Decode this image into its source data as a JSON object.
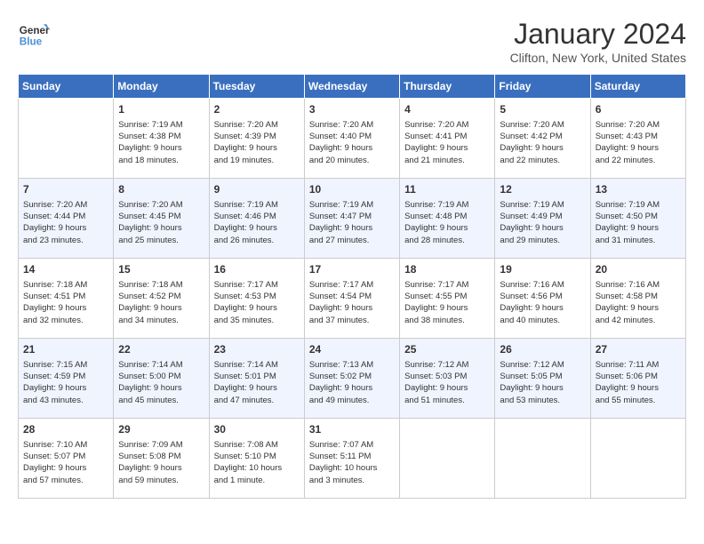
{
  "logo": {
    "text_general": "General",
    "text_blue": "Blue"
  },
  "header": {
    "month": "January 2024",
    "location": "Clifton, New York, United States"
  },
  "days_of_week": [
    "Sunday",
    "Monday",
    "Tuesday",
    "Wednesday",
    "Thursday",
    "Friday",
    "Saturday"
  ],
  "weeks": [
    [
      {
        "day": "",
        "info": ""
      },
      {
        "day": "1",
        "info": "Sunrise: 7:19 AM\nSunset: 4:38 PM\nDaylight: 9 hours\nand 18 minutes."
      },
      {
        "day": "2",
        "info": "Sunrise: 7:20 AM\nSunset: 4:39 PM\nDaylight: 9 hours\nand 19 minutes."
      },
      {
        "day": "3",
        "info": "Sunrise: 7:20 AM\nSunset: 4:40 PM\nDaylight: 9 hours\nand 20 minutes."
      },
      {
        "day": "4",
        "info": "Sunrise: 7:20 AM\nSunset: 4:41 PM\nDaylight: 9 hours\nand 21 minutes."
      },
      {
        "day": "5",
        "info": "Sunrise: 7:20 AM\nSunset: 4:42 PM\nDaylight: 9 hours\nand 22 minutes."
      },
      {
        "day": "6",
        "info": "Sunrise: 7:20 AM\nSunset: 4:43 PM\nDaylight: 9 hours\nand 22 minutes."
      }
    ],
    [
      {
        "day": "7",
        "info": "Sunrise: 7:20 AM\nSunset: 4:44 PM\nDaylight: 9 hours\nand 23 minutes."
      },
      {
        "day": "8",
        "info": "Sunrise: 7:20 AM\nSunset: 4:45 PM\nDaylight: 9 hours\nand 25 minutes."
      },
      {
        "day": "9",
        "info": "Sunrise: 7:19 AM\nSunset: 4:46 PM\nDaylight: 9 hours\nand 26 minutes."
      },
      {
        "day": "10",
        "info": "Sunrise: 7:19 AM\nSunset: 4:47 PM\nDaylight: 9 hours\nand 27 minutes."
      },
      {
        "day": "11",
        "info": "Sunrise: 7:19 AM\nSunset: 4:48 PM\nDaylight: 9 hours\nand 28 minutes."
      },
      {
        "day": "12",
        "info": "Sunrise: 7:19 AM\nSunset: 4:49 PM\nDaylight: 9 hours\nand 29 minutes."
      },
      {
        "day": "13",
        "info": "Sunrise: 7:19 AM\nSunset: 4:50 PM\nDaylight: 9 hours\nand 31 minutes."
      }
    ],
    [
      {
        "day": "14",
        "info": "Sunrise: 7:18 AM\nSunset: 4:51 PM\nDaylight: 9 hours\nand 32 minutes."
      },
      {
        "day": "15",
        "info": "Sunrise: 7:18 AM\nSunset: 4:52 PM\nDaylight: 9 hours\nand 34 minutes."
      },
      {
        "day": "16",
        "info": "Sunrise: 7:17 AM\nSunset: 4:53 PM\nDaylight: 9 hours\nand 35 minutes."
      },
      {
        "day": "17",
        "info": "Sunrise: 7:17 AM\nSunset: 4:54 PM\nDaylight: 9 hours\nand 37 minutes."
      },
      {
        "day": "18",
        "info": "Sunrise: 7:17 AM\nSunset: 4:55 PM\nDaylight: 9 hours\nand 38 minutes."
      },
      {
        "day": "19",
        "info": "Sunrise: 7:16 AM\nSunset: 4:56 PM\nDaylight: 9 hours\nand 40 minutes."
      },
      {
        "day": "20",
        "info": "Sunrise: 7:16 AM\nSunset: 4:58 PM\nDaylight: 9 hours\nand 42 minutes."
      }
    ],
    [
      {
        "day": "21",
        "info": "Sunrise: 7:15 AM\nSunset: 4:59 PM\nDaylight: 9 hours\nand 43 minutes."
      },
      {
        "day": "22",
        "info": "Sunrise: 7:14 AM\nSunset: 5:00 PM\nDaylight: 9 hours\nand 45 minutes."
      },
      {
        "day": "23",
        "info": "Sunrise: 7:14 AM\nSunset: 5:01 PM\nDaylight: 9 hours\nand 47 minutes."
      },
      {
        "day": "24",
        "info": "Sunrise: 7:13 AM\nSunset: 5:02 PM\nDaylight: 9 hours\nand 49 minutes."
      },
      {
        "day": "25",
        "info": "Sunrise: 7:12 AM\nSunset: 5:03 PM\nDaylight: 9 hours\nand 51 minutes."
      },
      {
        "day": "26",
        "info": "Sunrise: 7:12 AM\nSunset: 5:05 PM\nDaylight: 9 hours\nand 53 minutes."
      },
      {
        "day": "27",
        "info": "Sunrise: 7:11 AM\nSunset: 5:06 PM\nDaylight: 9 hours\nand 55 minutes."
      }
    ],
    [
      {
        "day": "28",
        "info": "Sunrise: 7:10 AM\nSunset: 5:07 PM\nDaylight: 9 hours\nand 57 minutes."
      },
      {
        "day": "29",
        "info": "Sunrise: 7:09 AM\nSunset: 5:08 PM\nDaylight: 9 hours\nand 59 minutes."
      },
      {
        "day": "30",
        "info": "Sunrise: 7:08 AM\nSunset: 5:10 PM\nDaylight: 10 hours\nand 1 minute."
      },
      {
        "day": "31",
        "info": "Sunrise: 7:07 AM\nSunset: 5:11 PM\nDaylight: 10 hours\nand 3 minutes."
      },
      {
        "day": "",
        "info": ""
      },
      {
        "day": "",
        "info": ""
      },
      {
        "day": "",
        "info": ""
      }
    ]
  ]
}
